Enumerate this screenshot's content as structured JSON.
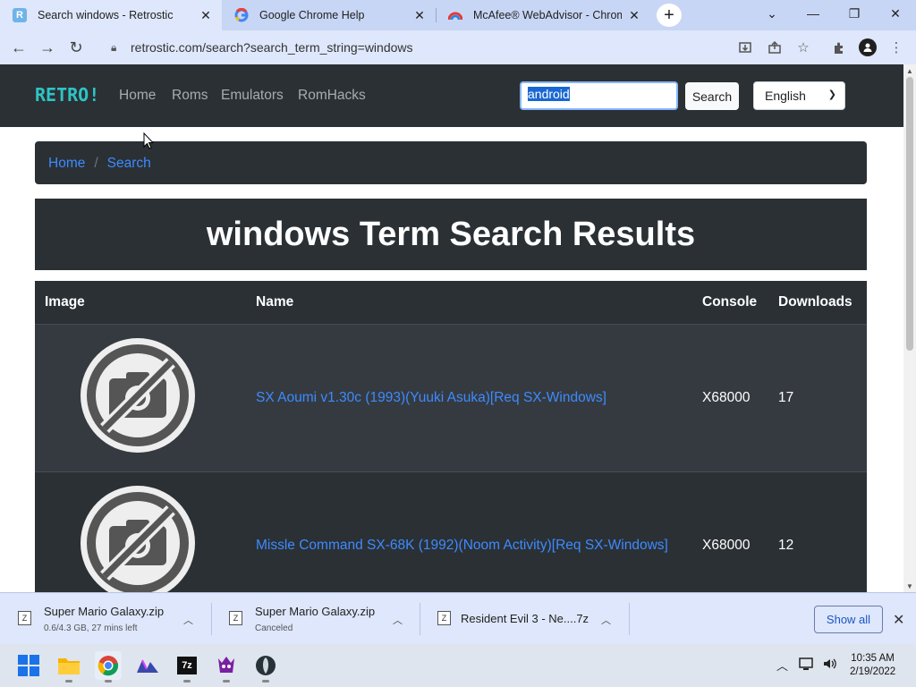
{
  "browser": {
    "tabs": [
      {
        "title": "Search windows - Retrostic",
        "active": true
      },
      {
        "title": "Google Chrome Help",
        "active": false
      },
      {
        "title": "McAfee® WebAdvisor - Chrome",
        "active": false
      }
    ],
    "new_tab_symbol": "+",
    "url": "retrostic.com/search?search_term_string=windows"
  },
  "site": {
    "brand": "RETRO!",
    "nav": [
      "Home",
      "Roms",
      "Emulators",
      "RomHacks"
    ],
    "search_value": "android",
    "search_button": "Search",
    "language": "English",
    "colors": {
      "nav_bg": "#2b3035",
      "brand": "#2ec4c4",
      "link": "#3d8bfd"
    }
  },
  "breadcrumb": [
    "Home",
    "Search"
  ],
  "page_title": "windows Term Search Results",
  "table": {
    "headers": [
      "Image",
      "Name",
      "Console",
      "Downloads"
    ],
    "rows": [
      {
        "name": "SX Aoumi v1.30c (1993)(Yuuki Asuka)[Req SX-Windows]",
        "console": "X68000",
        "downloads": "17"
      },
      {
        "name": "Missle Command SX-68K (1992)(Noom Activity)[Req SX-Windows]",
        "console": "X68000",
        "downloads": "12"
      }
    ]
  },
  "downloads": [
    {
      "name": "Super Mario Galaxy.zip",
      "status": "0.6/4.3 GB, 27 mins left"
    },
    {
      "name": "Super Mario Galaxy.zip",
      "status": "Canceled"
    },
    {
      "name": "Resident Evil 3 - Ne....7z",
      "status": ""
    }
  ],
  "download_bar": {
    "show_all": "Show all"
  },
  "taskbar": {
    "apps": [
      "windows-start-icon",
      "file-explorer-icon",
      "chrome-icon",
      "app-icon",
      "7zip-icon",
      "game-icon",
      "app2-icon"
    ],
    "time": "10:35 AM",
    "date": "2/19/2022"
  }
}
